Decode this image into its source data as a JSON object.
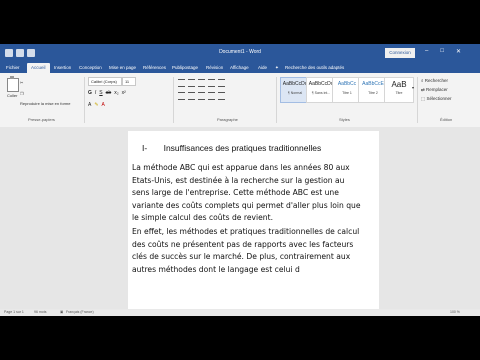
{
  "window": {
    "title": "Document1 - Word",
    "signin": "Connexion"
  },
  "tabs": [
    "Fichier",
    "Accueil",
    "Insertion",
    "Conception",
    "Mise en page",
    "Références",
    "Publipostage",
    "Révision",
    "Affichage",
    "Aide"
  ],
  "search_label": "Recherche des outils adaptés",
  "ribbon": {
    "paste_label": "Coller",
    "clipboard_label": "Presse-papiers",
    "paragraph_label": "Paragraphe",
    "styles_label": "Styles",
    "editing_label": "Édition",
    "format_painter": "Reproduire la mise en forme",
    "font_name": "Calibri (Corps)",
    "font_size": "11",
    "styles": [
      {
        "sample": "AaBbCcDc",
        "name": "¶ Normal"
      },
      {
        "sample": "AaBbCcDc",
        "name": "¶ Sans int..."
      },
      {
        "sample": "AaBbCc",
        "name": "Titre 1"
      },
      {
        "sample": "AaBbCcE",
        "name": "Titre 2"
      },
      {
        "sample": "AaB",
        "name": "Titre"
      }
    ],
    "editing": [
      "Rechercher",
      "Remplacer",
      "Sélectionner"
    ]
  },
  "document": {
    "heading_number": "I-",
    "heading_text": "Insuffisances des pratiques traditionnelles",
    "paragraph1": "La méthode ABC qui est apparue dans les années 80 aux Etats-Unis, est destinée à la recherche sur la gestion au sens large de l'entreprise. Cette méthode ABC est une variante des coûts complets qui permet d'aller plus loin que le simple calcul des coûts de revient.",
    "paragraph2": "En effet, les méthodes et pratiques traditionnelles de calcul des coûts ne présentent pas de rapports avec les facteurs clés de succès sur le marché. De plus, contrairement aux autres méthodes dont le langage est celui d"
  },
  "status": {
    "page": "Page 1 sur 1",
    "words": "96 mots",
    "language": "Français (France)",
    "zoom": "100 %"
  },
  "colors": {
    "title_bar": "#2b579a",
    "canvas": "#e6e6e6",
    "ribbon": "#f3f3f3",
    "letterbox": "#000000"
  }
}
